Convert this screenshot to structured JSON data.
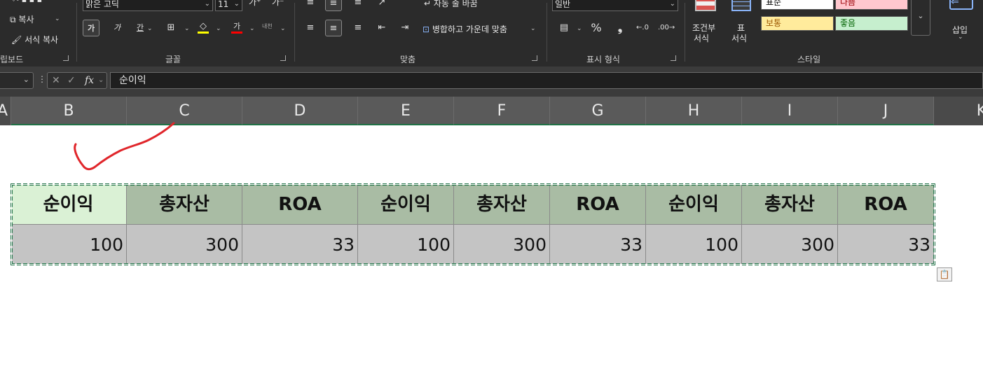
{
  "ribbon": {
    "clipboard": {
      "copy_label": "복사",
      "format_painter_label": "서식 복사",
      "group_label": "립보드"
    },
    "font": {
      "font_name": "맑은 고딕",
      "font_size": "11",
      "bold_label": "가",
      "italic_label": "가",
      "underline_label": "간",
      "font_color_label": "가",
      "increase_size_label": "가",
      "decrease_size_label": "가",
      "phonetic_label": "내천",
      "group_label": "글꼴"
    },
    "alignment": {
      "wrap_text_label": "자동 줄 바꿈",
      "merge_center_label": "병합하고 가운데 맞춤",
      "group_label": "맞춤"
    },
    "number": {
      "format_value": "일반",
      "percent_label": "%",
      "comma_label": "❟",
      "group_label": "표시 형식"
    },
    "styles": {
      "conditional_format_label1": "조건부",
      "conditional_format_label2": "서식",
      "table_label1": "표",
      "table_label2": "서식",
      "cell_styles": [
        {
          "label": "표준",
          "bg": "#ffffff",
          "fg": "#000000"
        },
        {
          "label": "나쁨",
          "bg": "#ffc7ce",
          "fg": "#9c0006"
        },
        {
          "label": "보통",
          "bg": "#ffeb9c",
          "fg": "#9c5700"
        },
        {
          "label": "좋음",
          "bg": "#c6efce",
          "fg": "#006100"
        }
      ],
      "group_label": "스타일"
    },
    "cells": {
      "insert_label": "삽입"
    }
  },
  "formula_bar": {
    "fx_label": "fx",
    "content": "순이익"
  },
  "columns": [
    "A",
    "B",
    "C",
    "D",
    "E",
    "F",
    "G",
    "H",
    "I",
    "J",
    "K"
  ],
  "table": {
    "headers": [
      "순이익",
      "총자산",
      "ROA",
      "순이익",
      "총자산",
      "ROA",
      "순이익",
      "총자산",
      "ROA"
    ],
    "values": [
      "100",
      "300",
      "33",
      "100",
      "300",
      "33",
      "100",
      "300",
      "33"
    ]
  },
  "colors": {
    "header_fill": "#a9bca4",
    "active_header_fill": "#daf1d5",
    "value_fill": "#c4c4c4",
    "selection_border": "#1e7145",
    "annotation_stroke": "#e0262b"
  }
}
